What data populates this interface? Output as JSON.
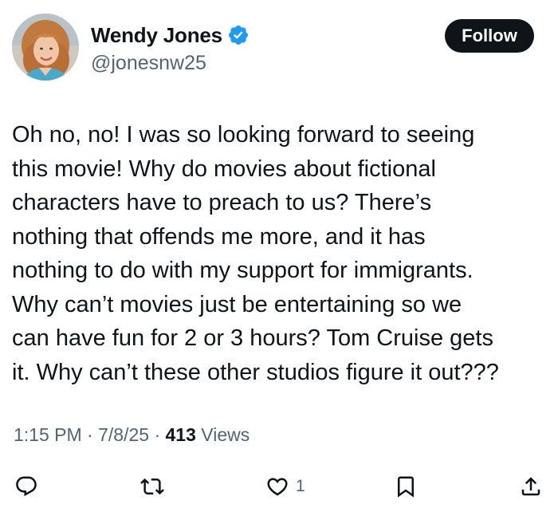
{
  "author": {
    "display_name": "Wendy Jones",
    "handle": "@jonesnw25",
    "verified": true,
    "avatar_icon": "profile-photo"
  },
  "follow_label": "Follow",
  "tweet": {
    "text": "Oh no, no! I was so looking forward to seeing\nthis movie! Why do movies about fictional\ncharacters have to preach to us? There’s\nnothing that offends me more, and it has\nnothing to do with my support for immigrants.\nWhy can’t movies just be entertaining so we\ncan have fun for 2 or 3 hours? Tom Cruise gets\nit. Why can’t these other studios figure it out???"
  },
  "meta": {
    "time": "1:15 PM",
    "separator": " · ",
    "date": "7/8/25",
    "views_count": "413",
    "views_label": " Views"
  },
  "actions": {
    "reply_icon": "reply-icon",
    "retweet_icon": "retweet-icon",
    "like_icon": "heart-icon",
    "like_count": "1",
    "bookmark_icon": "bookmark-icon",
    "share_icon": "share-icon"
  },
  "colors": {
    "text_primary": "#0f1419",
    "text_secondary": "#536471",
    "verified_blue": "#1d9bf0",
    "follow_bg": "#0f1419",
    "follow_text": "#ffffff"
  }
}
